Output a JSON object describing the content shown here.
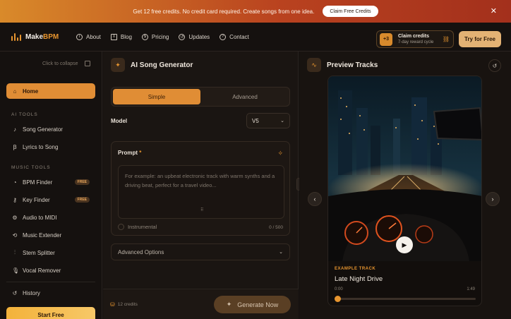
{
  "promo": {
    "text": "Get 12 free credits. No credit card required. Create songs from one idea.",
    "cta": "Claim Free Credits",
    "close": "✕"
  },
  "nav": {
    "logo_prefix": "Make",
    "logo_suffix": "BPM",
    "links": [
      {
        "label": "About",
        "icon": "info-icon"
      },
      {
        "label": "Blog",
        "icon": "blog-icon"
      },
      {
        "label": "Pricing",
        "icon": "pricing-icon"
      },
      {
        "label": "Updates",
        "icon": "history-icon"
      },
      {
        "label": "Contact",
        "icon": "help-icon"
      }
    ],
    "claim_badge": "+3",
    "claim_title": "Claim credits",
    "claim_sub": "7-day reward cycle",
    "try_button": "Try for Free"
  },
  "sidebar": {
    "collapse": "Click to collapse",
    "home": "Home",
    "ai_tools_head": "AI TOOLS",
    "ai_tools": [
      {
        "label": "Song Generator",
        "icon": "note-icon"
      },
      {
        "label": "Lyrics to Song",
        "icon": "lyrics-icon"
      }
    ],
    "music_tools_head": "MUSIC TOOLS",
    "music_tools": [
      {
        "label": "BPM Finder",
        "badge": "FREE",
        "icon": "gauge-icon"
      },
      {
        "label": "Key Finder",
        "badge": "FREE",
        "icon": "key-icon"
      },
      {
        "label": "Audio to MIDI",
        "icon": "midi-icon"
      },
      {
        "label": "Music Extender",
        "icon": "extend-icon"
      },
      {
        "label": "Stem Splitter",
        "icon": "stems-icon"
      },
      {
        "label": "Vocal Remover",
        "icon": "mic-icon"
      }
    ],
    "history": "History",
    "start": "Start Free"
  },
  "generator": {
    "title": "AI Song Generator",
    "tab_simple": "Simple",
    "tab_advanced": "Advanced",
    "active_tab": "Simple",
    "model_label": "Model",
    "model_value": "V5",
    "prompt_label": "Prompt",
    "prompt_required": "*",
    "prompt_placeholder": "For example: an upbeat electronic track with warm synths and a driving beat, perfect for a travel video...",
    "instrumental_label": "Instrumental",
    "counter": "0 / 500",
    "advanced_options": "Advanced Options",
    "credits": "12 credits",
    "generate_button": "Generate Now"
  },
  "preview": {
    "title": "Preview Tracks",
    "track_label": "EXAMPLE TRACK",
    "track_title": "Late Night Drive",
    "time_start": "0:00",
    "time_end": "1:49",
    "progress": 0
  },
  "colors": {
    "accent": "#e08d35",
    "promo_start": "#d98a2a",
    "promo_end": "#a3301c",
    "background": "#141110"
  }
}
